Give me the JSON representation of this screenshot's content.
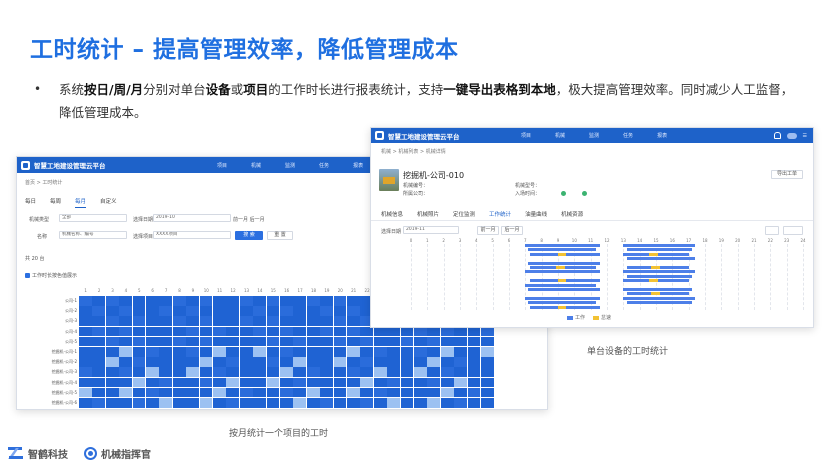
{
  "header": {
    "title": "工时统计 – 提高管理效率，降低管理成本"
  },
  "bullet": {
    "dot": "•",
    "t1": "系统",
    "b1": "按日/周/月",
    "t2": "分别对单台",
    "b2": "设备",
    "t3": "或",
    "b3": "项目",
    "t4": "的工作时长进行报表统计，支持",
    "b4": "一键导出表格到本地",
    "t5": "，极大提高管理效率。同时减少人工监督，降低管理成本。"
  },
  "left_screen": {
    "brand": "智慧工地建设管理云平台",
    "nav": [
      "项目",
      "机械",
      "监测",
      "任务",
      "报表"
    ],
    "breadcrumb": "首页 > 工时统计",
    "tabs": [
      "每日",
      "每周",
      "每月",
      "自定义"
    ],
    "filters": {
      "type_label": "机械类型",
      "type_value": "全部",
      "date_label": "选择日期",
      "date_value": "2019-10",
      "range_value": "前一月   后一月",
      "name_label": "名称",
      "name_placeholder": "机械名称、编号",
      "project_label": "选择项目",
      "project_value": "XXXX项目"
    },
    "search_button": "搜 索",
    "reset_button": "重 置",
    "count_label": "共 20 台",
    "check_label": "工作时长按色值展示",
    "days": [
      "1",
      "2",
      "3",
      "4",
      "5",
      "6",
      "7",
      "8",
      "9",
      "10",
      "11",
      "12",
      "13",
      "14",
      "15",
      "16",
      "17",
      "18",
      "19",
      "20",
      "21",
      "22",
      "23",
      "24",
      "25",
      "26",
      "27",
      "28",
      "29",
      "30",
      "31"
    ],
    "rows": [
      "公司-1",
      "公司-2",
      "公司-3",
      "公司-4",
      "公司-5",
      "挖掘机-公司-1",
      "挖掘机-公司-2",
      "挖掘机-公司-3",
      "挖掘机-公司-4",
      "挖掘机-公司-5",
      "挖掘机-公司-6"
    ],
    "totals": [
      [
        "",
        ""
      ],
      [
        "",
        ""
      ],
      [
        "",
        ""
      ],
      [
        "",
        ""
      ],
      [
        "",
        ""
      ],
      [
        "",
        ""
      ],
      [
        "",
        ""
      ],
      [
        "",
        ""
      ],
      [
        "",
        ""
      ],
      [
        "",
        ""
      ],
      [
        "",
        ""
      ]
    ]
  },
  "right_screen": {
    "brand": "智慧工地建设管理云平台",
    "nav": [
      "项目",
      "机械",
      "监测",
      "任务",
      "报表"
    ],
    "breadcrumb": "机械 > 机械列表 > 机械详情",
    "machine_name": "挖掘机-公司-010",
    "info_left": [
      "机械编号：",
      "所属公司："
    ],
    "info_mid": [
      "机械型号：",
      "入场时间："
    ],
    "export_button": "导出工单",
    "tabs": [
      "机械信息",
      "机械照片",
      "定位监测",
      "工作统计",
      "油量曲线",
      "机械资源"
    ],
    "active_tab": 3,
    "date_label": "选择日期",
    "date_value": "2019-11",
    "prev_button": "前一月",
    "next_button": "后一月",
    "legend": [
      "工作",
      "怠速"
    ],
    "hours": [
      "0",
      "1",
      "2",
      "3",
      "4",
      "5",
      "6",
      "7",
      "8",
      "9",
      "10",
      "11",
      "12",
      "13",
      "14",
      "15",
      "16",
      "17",
      "18",
      "19",
      "20",
      "21",
      "22",
      "23",
      "24"
    ]
  },
  "captions": {
    "right": "单台设备的工时统计",
    "left": "按月统计一个项目的工时"
  },
  "footer": {
    "brand1": "智鹤科技",
    "brand2": "机械指挥官"
  },
  "colors": {
    "title_blue": "#1f6fe0",
    "topbar": "#1e62c9",
    "heat_dark": "#1f63d3",
    "heat_light": "#9cc1f2",
    "bar_work": "#4d7fe8",
    "bar_idle": "#f2c233"
  }
}
